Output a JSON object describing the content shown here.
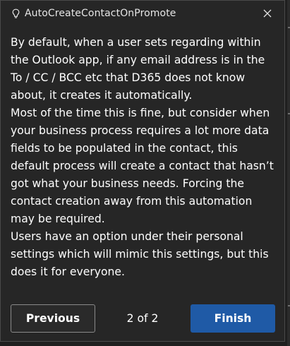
{
  "header": {
    "title": "AutoCreateContactOnPromote",
    "icon": "lightbulb-icon",
    "close_icon": "close-icon"
  },
  "body": {
    "paragraphs": [
      "By default, when a user sets regarding within the Outlook app, if any email address is in the To / CC / BCC etc that D365 does not know about, it creates it automatically.",
      "Most of the time this is fine, but consider when your business process requires a lot more data fields to be populated in the contact, this default process will create a contact that hasn’t got what your business needs. Forcing the contact creation away from this automation may be required.",
      "Users have an option under their personal settings which will mimic this settings, but this does it for everyone."
    ]
  },
  "footer": {
    "previous_label": "Previous",
    "step_counter": "2 of 2",
    "finish_label": "Finish"
  },
  "colors": {
    "background": "#262626",
    "accent": "#1f5aa6",
    "text": "#ffffff"
  }
}
